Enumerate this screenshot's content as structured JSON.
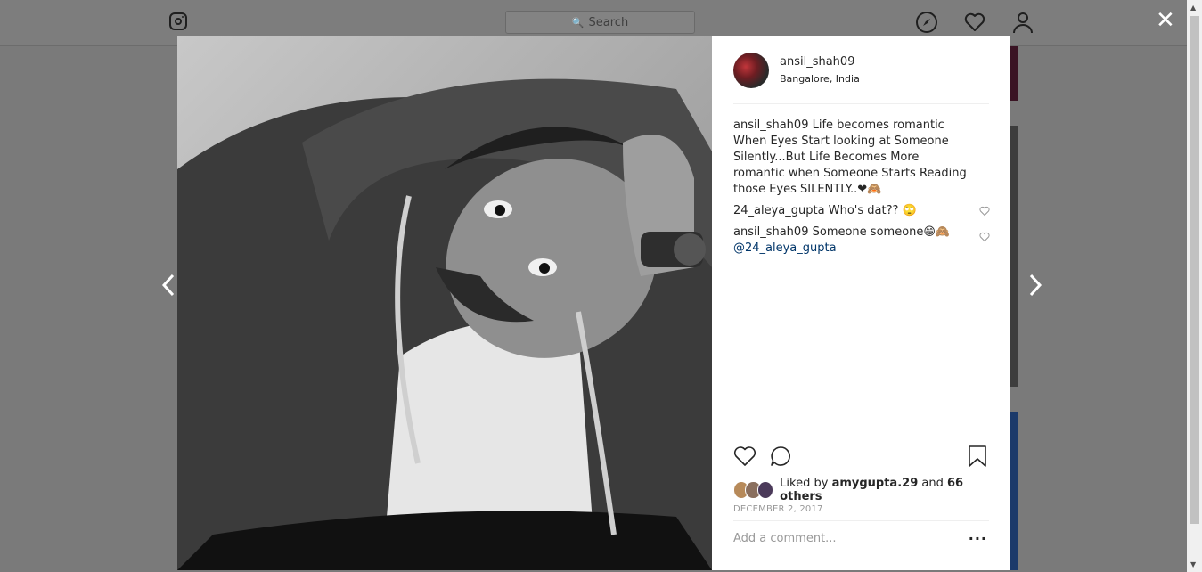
{
  "topbar": {
    "search_placeholder": "Search",
    "icons": [
      "instagram-logo",
      "compass-icon",
      "heart-icon",
      "user-icon"
    ]
  },
  "modal": {
    "close_label": "✕",
    "post": {
      "username": "ansil_shah09",
      "location": "Bangalore, India",
      "caption": {
        "user": "ansil_shah09",
        "text": "Life becomes romantic When Eyes Start looking at Someone Silently...But Life Becomes More romantic when Someone Starts Reading those Eyes SILENTLY..❤🙈"
      },
      "comments": [
        {
          "user": "24_aleya_gupta",
          "text": "Who's dat?? 🙄"
        },
        {
          "user": "ansil_shah09",
          "text": "Someone someone😁🙈",
          "mention": "@24_aleya_gupta"
        }
      ],
      "likes": {
        "prefix": "Liked by",
        "user": "amygupta.29",
        "middle": "and",
        "others": "66 others"
      },
      "date": "DECEMBER 2, 2017",
      "add_comment_placeholder": "Add a comment...",
      "more_label": "···"
    }
  },
  "colors": {
    "overlay": "#7a7a7a",
    "text": "#262626",
    "mention": "#003569",
    "muted": "#999999"
  }
}
